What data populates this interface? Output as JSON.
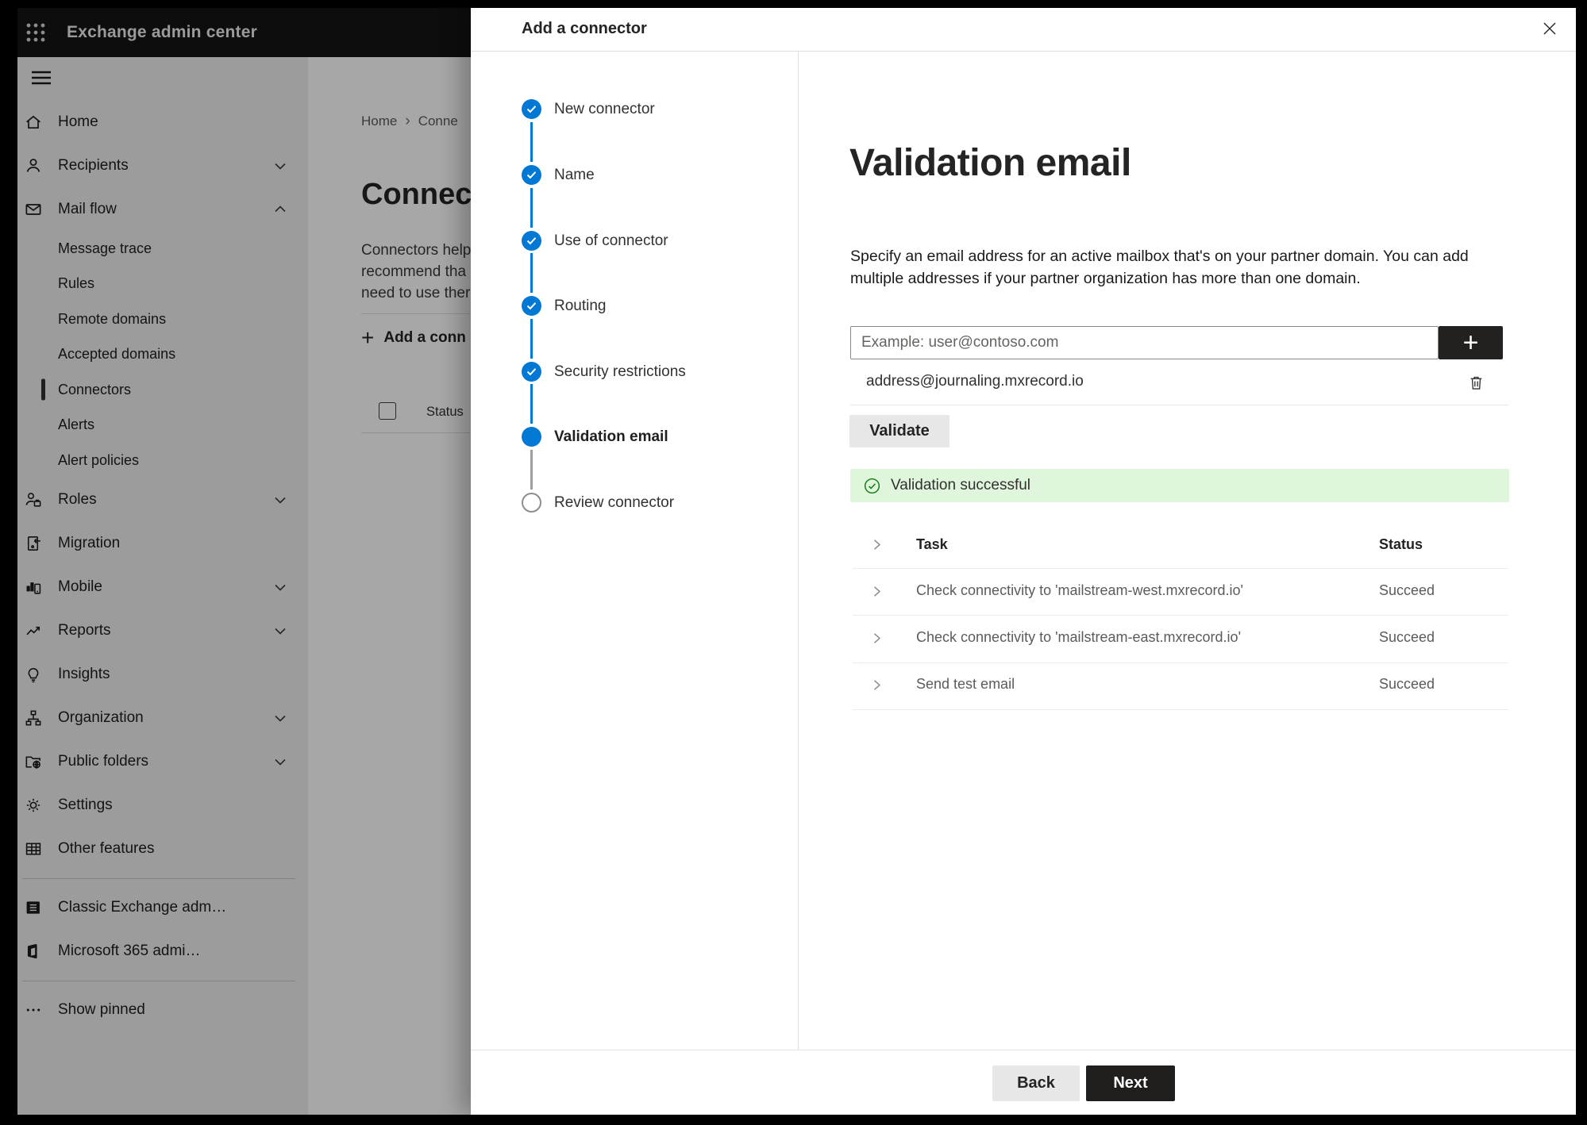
{
  "chrome": {
    "app_title": "Exchange admin center"
  },
  "colors": {
    "accent": "#0078d4",
    "success": "#107c10",
    "success_bg": "#dff6dd",
    "topbar": "#141414"
  },
  "icons": {
    "plus": "+",
    "breadcrumb_chevron": "›"
  },
  "sidebar": {
    "items": [
      {
        "label": "Home"
      },
      {
        "label": "Recipients"
      },
      {
        "label": "Mail flow"
      },
      {
        "label": "Message trace"
      },
      {
        "label": "Rules"
      },
      {
        "label": "Remote domains"
      },
      {
        "label": "Accepted domains"
      },
      {
        "label": "Connectors"
      },
      {
        "label": "Alerts"
      },
      {
        "label": "Alert policies"
      },
      {
        "label": "Roles"
      },
      {
        "label": "Migration"
      },
      {
        "label": "Mobile"
      },
      {
        "label": "Reports"
      },
      {
        "label": "Insights"
      },
      {
        "label": "Organization"
      },
      {
        "label": "Public folders"
      },
      {
        "label": "Settings"
      },
      {
        "label": "Other features"
      },
      {
        "label": "Classic Exchange adm…"
      },
      {
        "label": "Microsoft 365 admi…"
      },
      {
        "label": "Show pinned"
      }
    ]
  },
  "background": {
    "breadcrumb": {
      "home": "Home",
      "current": "Conne"
    },
    "page_title": "Connec",
    "description_lines": [
      "Connectors help",
      "recommend tha",
      "need to use ther"
    ],
    "add_button_label": "Add a conn",
    "list_header_status": "Status"
  },
  "panel": {
    "title": "Add a connector",
    "steps": [
      {
        "label": "New connector",
        "state": "done"
      },
      {
        "label": "Name",
        "state": "done"
      },
      {
        "label": "Use of connector",
        "state": "done"
      },
      {
        "label": "Routing",
        "state": "done"
      },
      {
        "label": "Security restrictions",
        "state": "done"
      },
      {
        "label": "Validation email",
        "state": "current"
      },
      {
        "label": "Review connector",
        "state": "todo"
      }
    ],
    "content": {
      "heading": "Validation email",
      "description": "Specify an email address for an active mailbox that's on your partner domain. You can add multiple addresses if your partner organization has more than one domain.",
      "input_placeholder": "Example: user@contoso.com",
      "added_address": "address@journaling.mxrecord.io",
      "validate_label": "Validate",
      "banner_text": "Validation successful",
      "table": {
        "task_header": "Task",
        "status_header": "Status",
        "rows": [
          {
            "task": "Check connectivity to 'mailstream-west.mxrecord.io'",
            "status": "Succeed"
          },
          {
            "task": "Check connectivity to 'mailstream-east.mxrecord.io'",
            "status": "Succeed"
          },
          {
            "task": "Send test email",
            "status": "Succeed"
          }
        ]
      }
    },
    "footer": {
      "back_label": "Back",
      "next_label": "Next"
    }
  }
}
